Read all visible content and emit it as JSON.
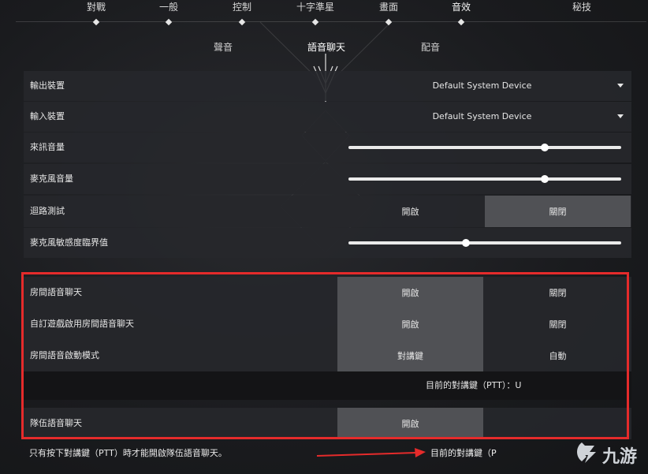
{
  "top_tabs": [
    {
      "label": "對戰"
    },
    {
      "label": "一般"
    },
    {
      "label": "控制"
    },
    {
      "label": "十字準星"
    },
    {
      "label": "畫面"
    },
    {
      "label": "音效"
    },
    {
      "label": "秘技"
    }
  ],
  "active_top_tab": "音效",
  "sub_tabs": [
    {
      "label": "聲音"
    },
    {
      "label": "語音聊天"
    },
    {
      "label": "配音"
    }
  ],
  "active_sub_tab": "語音聊天",
  "settings": {
    "output_device": {
      "label": "輸出裝置",
      "value": "Default System Device"
    },
    "input_device": {
      "label": "輸入裝置",
      "value": "Default System Device"
    },
    "incoming_volume": {
      "label": "來訊音量",
      "level": 0.72
    },
    "mic_volume": {
      "label": "麥克風音量",
      "level": 0.72
    },
    "loopback_test": {
      "label": "迴路測試",
      "on": "開啟",
      "off": "關閉",
      "selected": "off"
    },
    "mic_sensitivity": {
      "label": "麥克風敏感度臨界值",
      "level": 0.43
    },
    "room_voice_chat": {
      "label": "房間語音聊天",
      "on": "開啟",
      "off": "關閉",
      "selected": "on"
    },
    "custom_game_room_voice": {
      "label": "自訂遊戲啟用房間語音聊天",
      "on": "開啟",
      "off": "關閉",
      "selected": "on"
    },
    "room_voice_activation": {
      "label": "房間語音啟動模式",
      "ptt": "對講鍵",
      "auto": "自動",
      "selected": "ptt"
    },
    "current_ptt_room": "目前的對講鍵（PTT）：U",
    "team_voice_chat": {
      "label": "隊伍語音聊天",
      "on": "開啟",
      "selected": "on"
    }
  },
  "footer": {
    "note": "只有按下對講鍵（PTT）時才能開啟隊伍語音聊天。",
    "current_ptt_team": "目前的對講鍵（P"
  },
  "watermark": {
    "text": "九游",
    "color": "#cfd3d8"
  },
  "colors": {
    "annotation_red": "#e52b2b",
    "selected_bg": "#505155"
  }
}
